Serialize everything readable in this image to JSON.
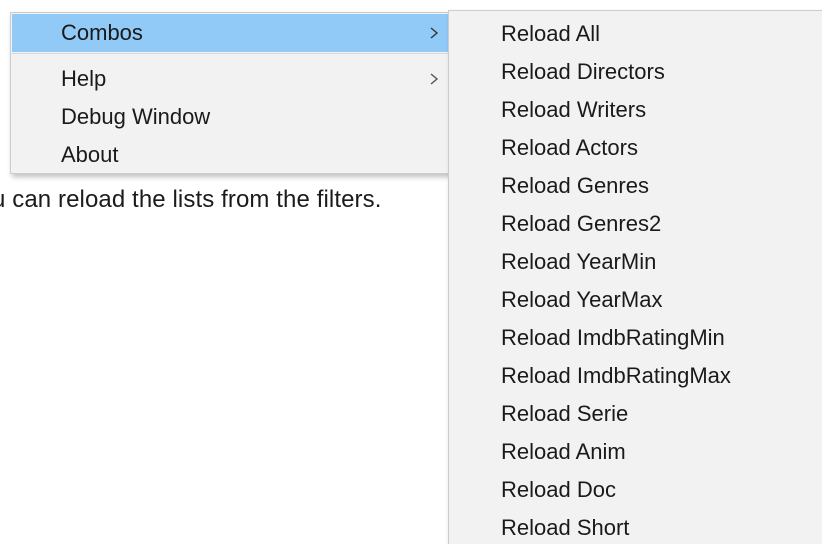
{
  "background": {
    "text": "u can reload the lists from the filters."
  },
  "main_menu": {
    "items": [
      {
        "label": "Combos",
        "has_submenu": true,
        "highlighted": true
      },
      {
        "label": "Help",
        "has_submenu": true,
        "highlighted": false
      },
      {
        "label": "Debug Window",
        "has_submenu": false,
        "highlighted": false
      },
      {
        "label": "About",
        "has_submenu": false,
        "highlighted": false
      }
    ],
    "highlight_color": "#91c9f7",
    "background_color": "#f2f2f2"
  },
  "sub_menu": {
    "items": [
      {
        "label": "Reload All"
      },
      {
        "label": "Reload Directors"
      },
      {
        "label": "Reload Writers"
      },
      {
        "label": "Reload Actors"
      },
      {
        "label": "Reload Genres"
      },
      {
        "label": "Reload Genres2"
      },
      {
        "label": "Reload YearMin"
      },
      {
        "label": "Reload YearMax"
      },
      {
        "label": "Reload ImdbRatingMin"
      },
      {
        "label": "Reload ImdbRatingMax"
      },
      {
        "label": "Reload Serie"
      },
      {
        "label": "Reload Anim"
      },
      {
        "label": "Reload Doc"
      },
      {
        "label": "Reload Short"
      }
    ]
  },
  "icons": {
    "submenu_arrow": "chevron-right-icon"
  }
}
